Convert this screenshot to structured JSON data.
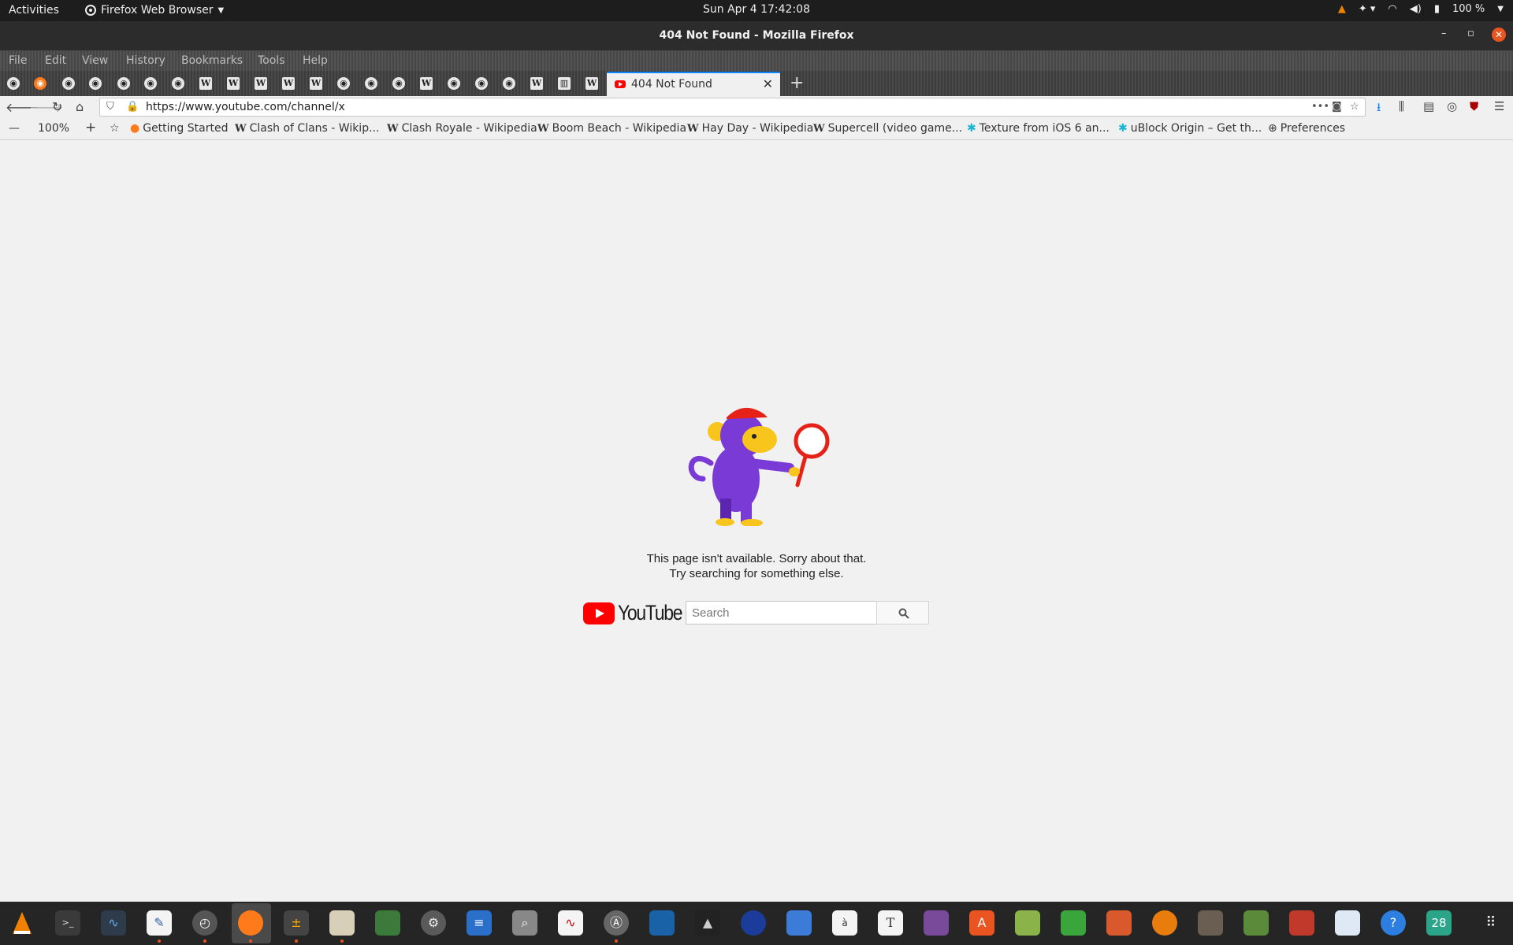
{
  "topbar": {
    "activities": "Activities",
    "app_name": "Firefox Web Browser",
    "clock": "Sun Apr 4  17:42:08",
    "battery": "100 %"
  },
  "window": {
    "title": "404 Not Found - Mozilla Firefox"
  },
  "menu": {
    "file": "File",
    "edit": "Edit",
    "view": "View",
    "history": "History",
    "bookmarks": "Bookmarks",
    "tools": "Tools",
    "help": "Help"
  },
  "tab": {
    "title": "404 Not Found"
  },
  "address": {
    "url": "https://www.youtube.com/channel/x"
  },
  "zoom": "100%",
  "bookmarks": [
    "Getting Started",
    "Clash of Clans - Wikip...",
    "Clash Royale - Wikipedia",
    "Boom Beach - Wikipedia",
    "Hay Day - Wikipedia",
    "Supercell (video game...",
    "Texture from iOS 6 an...",
    "uBlock Origin – Get th...",
    "Preferences"
  ],
  "page": {
    "message_line1": "This page isn't available. Sorry about that.",
    "message_line2": "Try searching for something else.",
    "logo_text": "YouTube",
    "search_placeholder": "Search"
  },
  "dock": {
    "calendar_day": "28"
  },
  "colors": {
    "accent": "#e95420",
    "youtube_red": "#ff0000",
    "monkey_purple": "#7a3ad6",
    "monkey_yellow": "#f7c51b"
  }
}
